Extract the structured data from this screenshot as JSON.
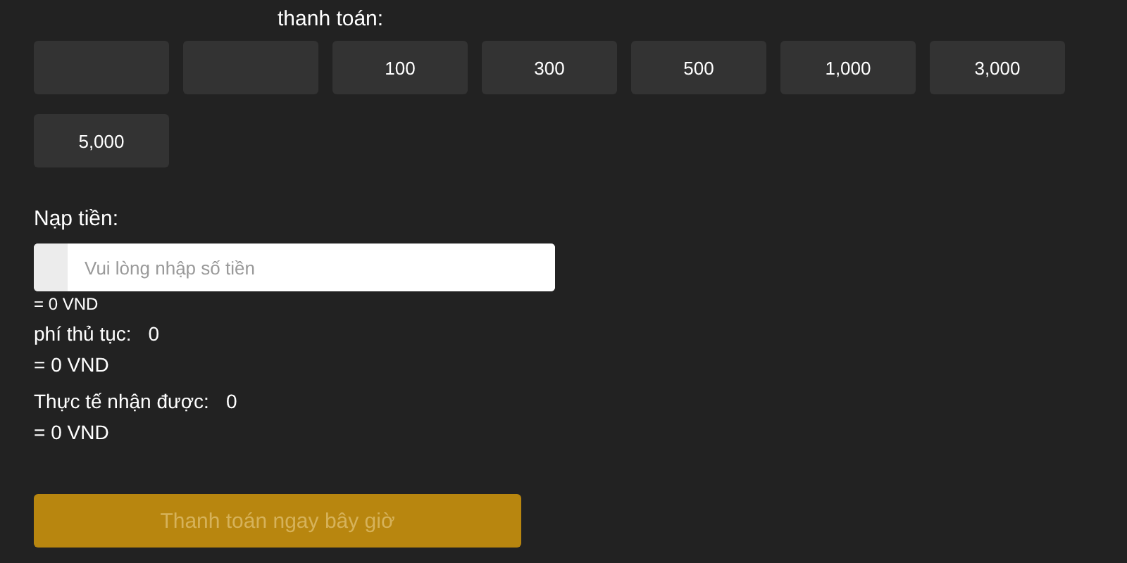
{
  "amount_label": "thanh toán:",
  "amounts": [
    {
      "kind": "blank"
    },
    {
      "kind": "blank"
    },
    {
      "kind": "value",
      "label": "100"
    },
    {
      "kind": "value",
      "label": "300"
    },
    {
      "kind": "value",
      "label": "500"
    },
    {
      "kind": "value",
      "label": "1,000"
    },
    {
      "kind": "value",
      "label": "3,000"
    },
    {
      "kind": "value",
      "label": "5,000"
    }
  ],
  "deposit": {
    "label": "Nạp tiền:",
    "placeholder": "Vui lòng nhập số tiền",
    "converted": "= 0 VND"
  },
  "fee": {
    "label": "phí thủ tục:",
    "value": "0",
    "converted": "= 0 VND"
  },
  "received": {
    "label": "Thực tế nhận được:",
    "value": "0",
    "converted": "= 0 VND"
  },
  "pay_button": {
    "label": "Thanh toán ngay bây giờ",
    "disabled": true
  }
}
